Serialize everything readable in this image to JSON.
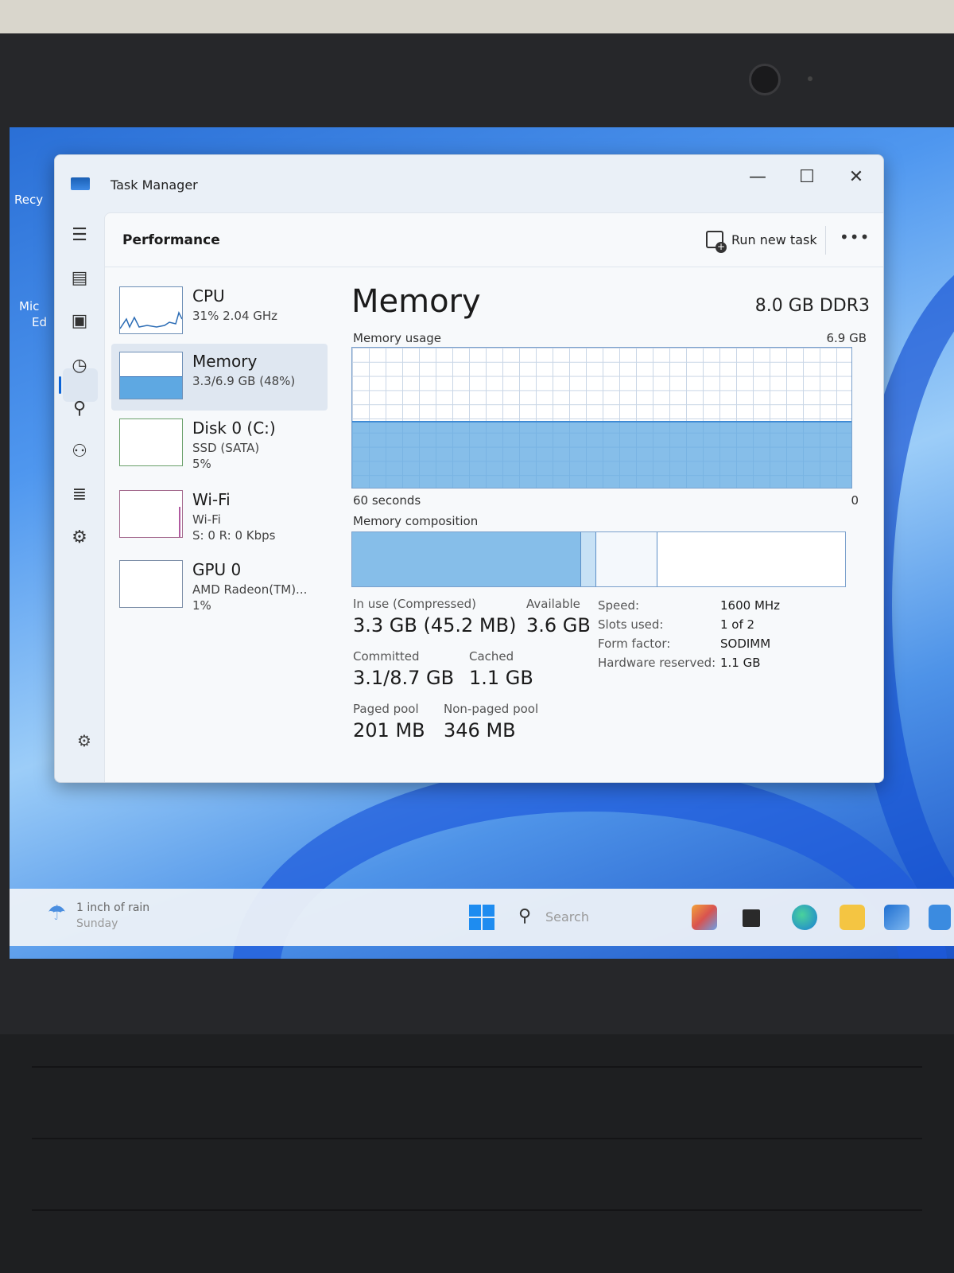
{
  "window": {
    "title": "Task Manager",
    "controls": {
      "minimize": "—",
      "maximize": "☐",
      "close": "✕"
    }
  },
  "header": {
    "page_title": "Performance",
    "run_new_task_label": "Run new task",
    "more_label": "•••"
  },
  "nav": {
    "icons": [
      "hamburger-icon",
      "processes-icon",
      "performance-icon",
      "app-history-icon",
      "startup-apps-icon",
      "users-icon",
      "details-icon",
      "services-icon"
    ],
    "settings_icon": "gear-icon"
  },
  "devices": [
    {
      "name": "CPU",
      "line1": "31% 2.04 GHz",
      "line2": "",
      "selected": false
    },
    {
      "name": "Memory",
      "line1": "3.3/6.9 GB (48%)",
      "line2": "",
      "selected": true
    },
    {
      "name": "Disk 0 (C:)",
      "line1": "SSD (SATA)",
      "line2": "5%",
      "selected": false
    },
    {
      "name": "Wi-Fi",
      "line1": "Wi-Fi",
      "line2": "S: 0 R: 0 Kbps",
      "selected": false
    },
    {
      "name": "GPU 0",
      "line1": "AMD Radeon(TM)...",
      "line2": "1%",
      "selected": false
    }
  ],
  "memory": {
    "title": "Memory",
    "spec": "8.0 GB DDR3",
    "usage_label": "Memory usage",
    "usage_max": "6.9 GB",
    "usage_fraction": 0.48,
    "axis_left": "60 seconds",
    "axis_right": "0",
    "composition_label": "Memory composition",
    "composition": {
      "in_use_fraction": 0.465,
      "modified_fraction": 0.03,
      "standby_fraction": 0.125
    },
    "stats": {
      "in_use_label": "In use (Compressed)",
      "in_use_value": "3.3 GB (45.2 MB)",
      "available_label": "Available",
      "available_value": "3.6 GB",
      "committed_label": "Committed",
      "committed_value": "3.1/8.7 GB",
      "cached_label": "Cached",
      "cached_value": "1.1 GB",
      "paged_label": "Paged pool",
      "paged_value": "201 MB",
      "nonpaged_label": "Non-paged pool",
      "nonpaged_value": "346 MB"
    },
    "specs": [
      {
        "key": "Speed:",
        "value": "1600 MHz"
      },
      {
        "key": "Slots used:",
        "value": "1 of 2"
      },
      {
        "key": "Form factor:",
        "value": "SODIMM"
      },
      {
        "key": "Hardware reserved:",
        "value": "1.1 GB"
      }
    ]
  },
  "desktop": {
    "icon_label_1": "Recy",
    "icon_label_2": "Mic",
    "icon_label_3": "Ed"
  },
  "taskbar": {
    "weather_line1": "1 inch of rain",
    "weather_line2": "Sunday",
    "search_placeholder": "Search"
  },
  "colors": {
    "accent": "#0b63d6",
    "graph_fill": "#5ea8e2",
    "window_bg": "#eaf0f7"
  }
}
